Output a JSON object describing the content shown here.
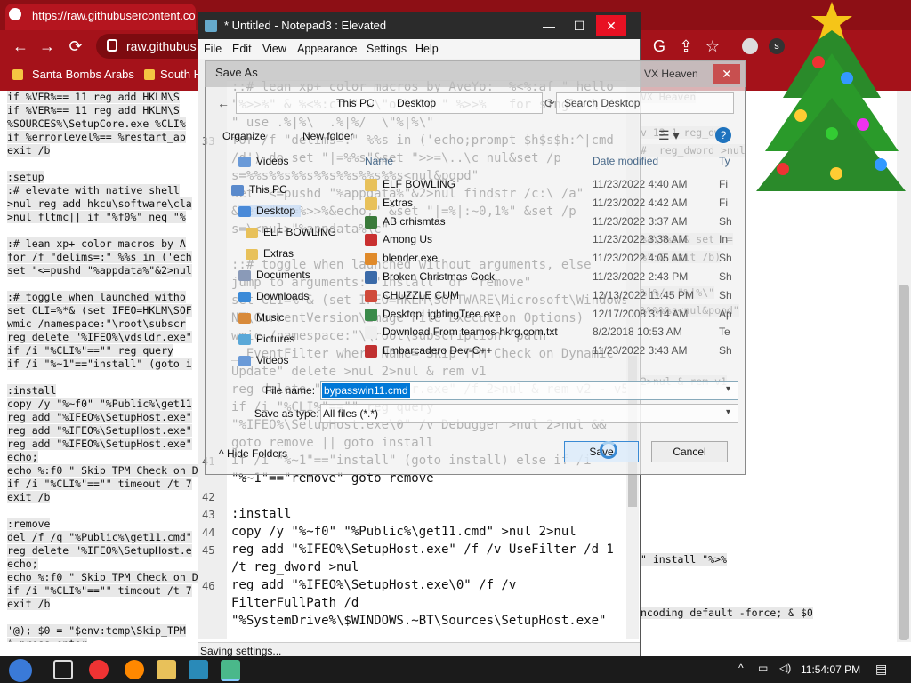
{
  "browser": {
    "url_tab": "https://raw.githubusercontent.co",
    "omnibox": "raw.githubus",
    "bookmarks": [
      "Santa Bombs Arabs",
      "South H"
    ]
  },
  "page_code_left": [
    "if %VER%== 11 reg add HKLM\\S",
    "if %VER%== 11 reg add HKLM\\S",
    "%SOURCES%\\SetupCore.exe %CLI%",
    "if %errorlevel%== %restart_ap",
    "exit /b",
    "",
    ":setup",
    ":# elevate with native shell",
    ">nul reg add hkcu\\software\\cla",
    ">nul fltmc|| if \"%f0%\" neq \"%",
    "",
    ":# lean xp+ color macros by A",
    "for /f \"delims=:\" %%s in ('ech",
    "set \"<=pushd \"%appdata%\"&2>nul",
    "",
    ":# toggle when launched witho",
    "set CLI=%*& (set IFEO=HKLM\\SOF",
    "wmic /namespace:\"\\root\\subscr",
    "reg delete \"%IFEO%\\vdsldr.exe\"",
    "if /i \"%CLI%\"==\"\" reg query",
    "if /i \"%~1\"==\"install\" (goto i",
    "",
    ":install",
    "copy /y \"%~f0\" \"%Public%\\get11",
    "reg add \"%IFEO%\\SetupHost.exe\"",
    "reg add \"%IFEO%\\SetupHost.exe\"",
    "reg add \"%IFEO%\\SetupHost.exe\"",
    "echo;",
    "echo %:f0 \" Skip TPM Check on Dy",
    "if /i \"%CLI%\"==\"\" timeout /t 7",
    "exit /b",
    "",
    ":remove",
    "del /f /q \"%Public%\\get11.cmd\"",
    "reg delete \"%IFEO%\\SetupHost.e",
    "echo;",
    "echo %:f0 \" Skip TPM Check on Dy",
    "if /i \"%CLI%\"==\"\" timeout /t 7",
    "exit /b",
    "",
    "'@); $0 = \"$env:temp\\Skip_TPM",
    "# press enter"
  ],
  "page_code_right": [
    "VX Heaven",
    "",
    "v 13 1 reg_dwo",
    "#  reg_dword >nul",
    "",
    "",
    "",
    "",
    "%a\\\"%3\"& set _=",
    "%\" & exit /b)",
    "",
    "%|%/  \"%|%\\\"",
    "%%%%%s<nul&popd\"",
    "",
    "",
    "",
    "2>nul & rem v1",
    "",
    "",
    "",
    "",
    "",
    "",
    "",
    "",
    "",
    "\" install \"%>%",
    "",
    "",
    "ncoding default -force; & $0"
  ],
  "notepad": {
    "title": "* Untitled - Notepad3 : Elevated",
    "menus": [
      "File",
      "Edit",
      "View",
      "Appearance",
      "Settings",
      "Help"
    ],
    "status": "Saving settings...",
    "lines": [
      {
        "n": "",
        "t": "::# lean xp+ color macros by AveYo:  %<%:af \" hello"
      },
      {
        "n": "",
        "t": "\"%>>%\" & %<%:cf \" w\\\"or\\\"ld \" %>>%   for single \\ / "
      },
      {
        "n": "",
        "t": "\" use .%|%\\  .%|%/  \\\"%|%\\\""
      },
      {
        "n": "33",
        "t": "for /f \"delims=:\" %%s in ('echo;prompt $h$s$h:^|cmd"
      },
      {
        "n": "",
        "t": "/d') do set \"|=%%s\"&set \">>=\\..\\c nul&set /p"
      },
      {
        "n": "",
        "t": "s=%%s%%s%%s%%s%%s%%s%%s<nul&popd\""
      },
      {
        "n": "",
        "t": "set \"<=pushd \"%appdata%\"&2>nul findstr /c:\\ /a\""
      },
      {
        "n": "",
        "t": "&set \">>=%>>%&echo;\" &set \"|=%|:~0,1%\" &set /p"
      },
      {
        "n": "",
        "t": "s=\\<nul>\"%appdata%\\c\""
      },
      {
        "n": "",
        "t": ""
      },
      {
        "n": "",
        "t": "::# toggle when launched without arguments, else"
      },
      {
        "n": "",
        "t": "jump to arguments: \"install\" or \"remove\""
      },
      {
        "n": "",
        "t": "set CLI=%*& (set IFEO=HKLM\\SOFTWARE\\Microsoft\\Windows"
      },
      {
        "n": "",
        "t": "NT\\CurrentVersion\\Image File Execution Options)"
      },
      {
        "n": "",
        "t": "wmic /namespace:\"\\\\root\\subscription\" path"
      },
      {
        "n": "",
        "t": "__EventFilter where Name=\"Skip TPM Check on Dynamic"
      },
      {
        "n": "",
        "t": "Update\" delete >nul 2>nul & rem v1"
      },
      {
        "n": "",
        "t": "reg delete \"%IFEO%\\vdsldr.exe\" /f 2>nul & rem v2 - v5"
      },
      {
        "n": "",
        "t": "if /i \"%CLI%\"==\"\" reg query"
      },
      {
        "n": "",
        "t": "\"%IFEO%\\SetupHost.exe\\0\" /v Debugger >nul 2>nul &&"
      },
      {
        "n": "",
        "t": "goto remove || goto install"
      },
      {
        "n": "41",
        "t": "if /i \"%~1\"==\"install\" (goto install) else if /i"
      },
      {
        "n": "",
        "t": "\"%~1\"==\"remove\" goto remove"
      },
      {
        "n": "42",
        "t": ""
      },
      {
        "n": "43",
        "t": ":install"
      },
      {
        "n": "44",
        "t": "copy /y \"%~f0\" \"%Public%\\get11.cmd\" >nul 2>nul"
      },
      {
        "n": "45",
        "t": "reg add \"%IFEO%\\SetupHost.exe\" /f /v UseFilter /d 1"
      },
      {
        "n": "",
        "t": "/t reg_dword >nul"
      },
      {
        "n": "46",
        "t": "reg add \"%IFEO%\\SetupHost.exe\\0\" /f /v"
      },
      {
        "n": "",
        "t": "FilterFullPath /d"
      },
      {
        "n": "",
        "t": "\"%SystemDrive%\\$WINDOWS.~BT\\Sources\\SetupHost.exe\""
      }
    ]
  },
  "save_as": {
    "title": "Save As",
    "overlay_title": "VX Heaven",
    "breadcrumb": [
      "This PC",
      "Desktop"
    ],
    "search_placeholder": "Search Desktop",
    "organize": "Organize",
    "new_folder": "New folder",
    "nav": [
      "Videos",
      "This PC",
      "Desktop",
      "ELF BOWLING",
      "Extras",
      "Documents",
      "Downloads",
      "Music",
      "Pictures",
      "Videos"
    ],
    "col_name": "Name",
    "col_date": "Date modified",
    "col_type": "Ty",
    "files": [
      {
        "name": "ELF BOWLING",
        "date": "11/23/2022 4:40 AM",
        "type": "Fi",
        "color": "#e8c15a"
      },
      {
        "name": "Extras",
        "date": "11/23/2022 4:42 AM",
        "type": "Fi",
        "color": "#e8c15a"
      },
      {
        "name": "AB crhismtas",
        "date": "11/23/2022 3:37 AM",
        "type": "Sh",
        "color": "#3a7a3a"
      },
      {
        "name": "Among Us",
        "date": "11/23/2022 3:38 AM",
        "type": "In",
        "color": "#c93030"
      },
      {
        "name": "blender.exe",
        "date": "11/23/2022 4:05 AM",
        "type": "Sh",
        "color": "#e08a2a"
      },
      {
        "name": "Broken Christmas Cock",
        "date": "11/23/2022 2:43 PM",
        "type": "Sh",
        "color": "#3a6aa8"
      },
      {
        "name": "CHUZZLE CUM",
        "date": "12/13/2022 11:45 PM",
        "type": "Sh",
        "color": "#d04a3a"
      },
      {
        "name": "DesktopLightingTree.exe",
        "date": "12/17/2008 3:14 AM",
        "type": "Ap",
        "color": "#3a8a4a"
      },
      {
        "name": "Download From teamos-hkrg.com.txt",
        "date": "8/2/2018 10:53 AM",
        "type": "Te",
        "color": "#eeeeee"
      },
      {
        "name": "Embarcadero Dev-C++",
        "date": "11/23/2022 3:43 AM",
        "type": "Sh",
        "color": "#c03030"
      }
    ],
    "filename_label": "File name:",
    "filename": "bypasswin11.cmd",
    "savetype_label": "Save as type:",
    "savetype": "All files (*.*)",
    "hide_folders": "Hide Folders",
    "save": "Save",
    "cancel": "Cancel"
  },
  "taskbar": {
    "clock": "11:54:07 PM"
  }
}
